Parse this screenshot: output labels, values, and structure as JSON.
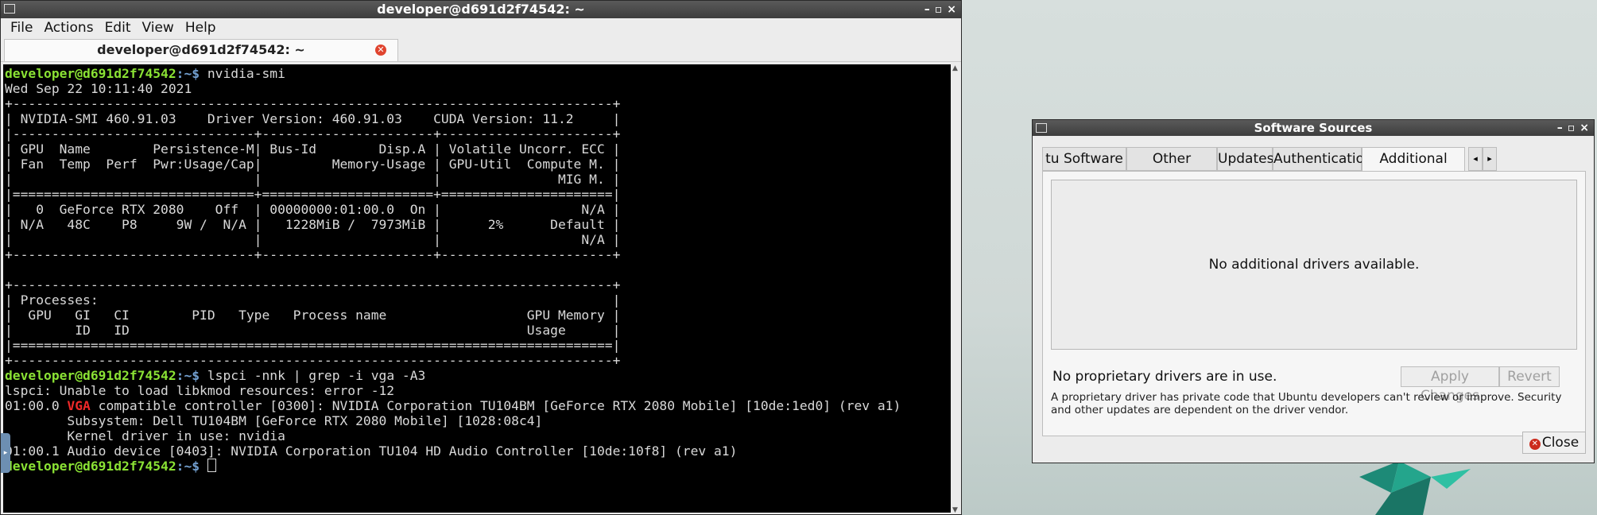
{
  "terminal": {
    "window_title": "developer@d691d2f74542: ~",
    "menu": [
      "File",
      "Actions",
      "Edit",
      "View",
      "Help"
    ],
    "tab_title": "developer@d691d2f74542: ~",
    "prompt_user": "developer@d691d2f74542",
    "prompt_path": ":~$",
    "lines": [
      {
        "kind": "prompt",
        "cmd": " nvidia-smi"
      },
      {
        "kind": "text",
        "text": "Wed Sep 22 10:11:40 2021"
      },
      {
        "kind": "text",
        "text": "+-----------------------------------------------------------------------------+"
      },
      {
        "kind": "text",
        "text": "| NVIDIA-SMI 460.91.03    Driver Version: 460.91.03    CUDA Version: 11.2     |"
      },
      {
        "kind": "text",
        "text": "|-------------------------------+----------------------+----------------------+"
      },
      {
        "kind": "text",
        "text": "| GPU  Name        Persistence-M| Bus-Id        Disp.A | Volatile Uncorr. ECC |"
      },
      {
        "kind": "text",
        "text": "| Fan  Temp  Perf  Pwr:Usage/Cap|         Memory-Usage | GPU-Util  Compute M. |"
      },
      {
        "kind": "text",
        "text": "|                               |                      |               MIG M. |"
      },
      {
        "kind": "text",
        "text": "|===============================+======================+======================|"
      },
      {
        "kind": "text",
        "text": "|   0  GeForce RTX 2080    Off  | 00000000:01:00.0  On |                  N/A |"
      },
      {
        "kind": "text",
        "text": "| N/A   48C    P8     9W /  N/A |   1228MiB /  7973MiB |      2%      Default |"
      },
      {
        "kind": "text",
        "text": "|                               |                      |                  N/A |"
      },
      {
        "kind": "text",
        "text": "+-------------------------------+----------------------+----------------------+"
      },
      {
        "kind": "text",
        "text": " "
      },
      {
        "kind": "text",
        "text": "+-----------------------------------------------------------------------------+"
      },
      {
        "kind": "text",
        "text": "| Processes:                                                                  |"
      },
      {
        "kind": "text",
        "text": "|  GPU   GI   CI        PID   Type   Process name                  GPU Memory |"
      },
      {
        "kind": "text",
        "text": "|        ID   ID                                                   Usage      |"
      },
      {
        "kind": "text",
        "text": "|=============================================================================|"
      },
      {
        "kind": "text",
        "text": "+-----------------------------------------------------------------------------+"
      },
      {
        "kind": "prompt",
        "cmd": " lspci -nnk | grep -i vga -A3"
      },
      {
        "kind": "text",
        "text": "lspci: Unable to load libkmod resources: error -12"
      },
      {
        "kind": "vga",
        "pre": "01:00.0 ",
        "hl": "VGA",
        "post": " compatible controller [0300]: NVIDIA Corporation TU104BM [GeForce RTX 2080 Mobile] [10de:1ed0] (rev a1)"
      },
      {
        "kind": "text",
        "text": "        Subsystem: Dell TU104BM [GeForce RTX 2080 Mobile] [1028:08c4]"
      },
      {
        "kind": "text",
        "text": "        Kernel driver in use: nvidia"
      },
      {
        "kind": "text",
        "text": "01:00.1 Audio device [0403]: NVIDIA Corporation TU104 HD Audio Controller [10de:10f8] (rev a1)"
      },
      {
        "kind": "cursor",
        "cmd": " "
      }
    ]
  },
  "dialog": {
    "title": "Software Sources",
    "tabs": [
      "tu Software",
      "Other Software",
      "Updates",
      "Authentication",
      "Additional Drivers"
    ],
    "active_tab": "Additional Drivers",
    "list_message": "No additional drivers available.",
    "status": "No proprietary drivers are in use.",
    "apply_label": "Apply Changes",
    "revert_label": "Revert",
    "note": "A proprietary driver has private code that Ubuntu developers can't review or improve. Security and other updates are dependent on the driver vendor.",
    "close_label": "Close"
  },
  "colors": {
    "prompt_user": "#8ae234",
    "prompt_path": "#729fcf",
    "highlight": "#ef2929",
    "terminal_bg": "#000000"
  }
}
